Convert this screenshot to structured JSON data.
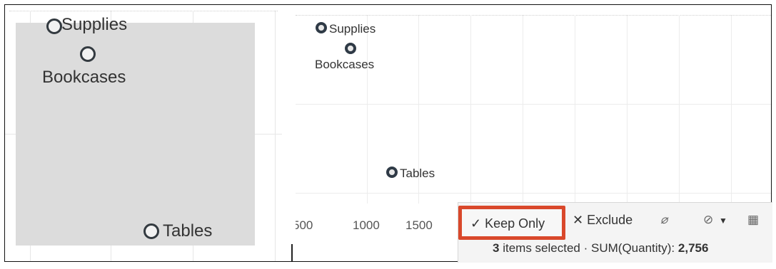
{
  "left_panel": {
    "labels": [
      "Supplies",
      "Bookcases",
      "Tables"
    ]
  },
  "right_panel": {
    "labels": [
      "Supplies",
      "Bookcases",
      "Tables"
    ],
    "x_ticks": [
      "500",
      "1000",
      "1500"
    ]
  },
  "toolbar": {
    "keep_only_label": "Keep Only",
    "keep_only_icon": "checkmark-icon",
    "exclude_label": "Exclude",
    "exclude_icon": "x-icon",
    "icons": [
      "paperclip-icon",
      "group-icon",
      "dropdown-icon",
      "table-view-icon"
    ],
    "highlight_color": "#d9482b"
  },
  "summary": {
    "count": "3",
    "count_text": "items selected",
    "separator": "·",
    "measure_label": "SUM(Quantity):",
    "measure_value": "2,756"
  }
}
